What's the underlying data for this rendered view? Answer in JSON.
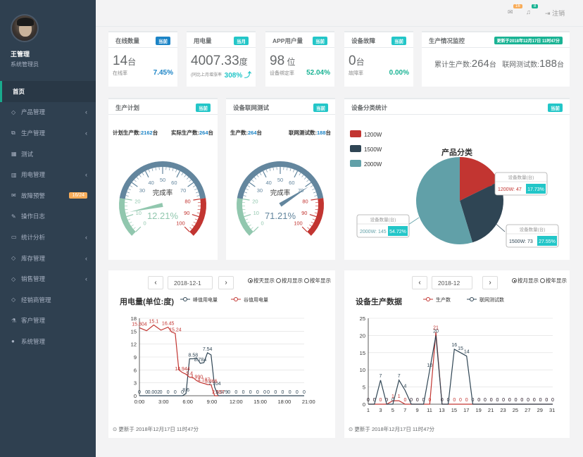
{
  "user": {
    "name": "王管理",
    "role": "系统管理员"
  },
  "nav": [
    {
      "label": "首页",
      "icon": "home",
      "active": true
    },
    {
      "label": "产品管理",
      "icon": "diamond-icon",
      "sym": "◇",
      "arrow": "‹"
    },
    {
      "label": "生产管理",
      "icon": "copy-icon",
      "sym": "⧉",
      "arrow": "‹"
    },
    {
      "label": "测试",
      "icon": "table-icon",
      "sym": "▦"
    },
    {
      "label": "用电管理",
      "icon": "bar-chart-icon",
      "sym": "▥",
      "arrow": "‹"
    },
    {
      "label": "故障预警",
      "icon": "envelope-icon",
      "sym": "✉",
      "badge": "16/24"
    },
    {
      "label": "操作日志",
      "icon": "edit-icon",
      "sym": "✎"
    },
    {
      "label": "统计分析",
      "icon": "desktop-icon",
      "sym": "▭",
      "arrow": "‹"
    },
    {
      "label": "库存管理",
      "icon": "diamond-icon",
      "sym": "◇",
      "arrow": "‹"
    },
    {
      "label": "销售管理",
      "icon": "diamond-icon",
      "sym": "◇",
      "arrow": "‹"
    },
    {
      "label": "经销商管理",
      "icon": "diamond-icon",
      "sym": "◇"
    },
    {
      "label": "客户管理",
      "icon": "flask-icon",
      "sym": "⚗"
    },
    {
      "label": "系统管理",
      "icon": "globe-icon",
      "sym": "●"
    }
  ],
  "topbar": {
    "mail_count": "16",
    "bell_count": "8",
    "logout": "注销"
  },
  "stats": {
    "online": {
      "title": "在线数量",
      "tag": "当前",
      "value": "14",
      "unit": "台",
      "sub": "在线率",
      "pct": "7.45%"
    },
    "power": {
      "title": "用电量",
      "tag": "当月",
      "value": "4007.33",
      "unit": "度",
      "sub": "(同比上月增涨率",
      "pct": "308% ⤴"
    },
    "app": {
      "title": "APP用户量",
      "tag": "当前",
      "value": "98",
      "unit": " 位",
      "sub": "设备绑定率",
      "pct": "52.04%"
    },
    "fault": {
      "title": "设备故障",
      "tag": "当前",
      "value": "0",
      "unit": "台",
      "sub": "故障率",
      "pct": "0.00%"
    },
    "monitor": {
      "title": "生产情况监控",
      "tag": "更新于2018年12月17日 11时47分",
      "a_label": "累计生产数:",
      "a_val": "264",
      "a_unit": "台",
      "b_label": "联网测试数:",
      "b_val": "188",
      "b_unit": "台"
    }
  },
  "plan": {
    "title": "生产计划",
    "tag": "当前",
    "left_label": "计划生产数:",
    "left_val": "2162",
    "left_unit": "台",
    "right_label": "实际生产数:",
    "right_val": "264",
    "right_unit": "台"
  },
  "nettest": {
    "title": "设备联网测试",
    "tag": "当前",
    "left_label": "生产数:",
    "left_val": "264",
    "left_unit": "台",
    "right_label": "联网测试数:",
    "right_val": "188",
    "right_unit": "台"
  },
  "gauges": [
    {
      "label": "完成率",
      "value": 12.21,
      "text": "12.21%",
      "ticks": [
        "0",
        "10",
        "20",
        "30",
        "40",
        "50",
        "60",
        "70",
        "80",
        "90",
        "100"
      ]
    },
    {
      "label": "完成率",
      "value": 71.21,
      "text": "71.21%",
      "ticks": [
        "0",
        "10",
        "20",
        "30",
        "40",
        "50",
        "60",
        "70",
        "80",
        "90",
        "100"
      ]
    }
  ],
  "pie_panel": {
    "title": "设备分类统计",
    "tag": "当前",
    "chart_title": "产品分类"
  },
  "pie": {
    "type": "pie",
    "legend": [
      "1200W",
      "1500W",
      "2000W"
    ],
    "colors": [
      "#c23531",
      "#2f4554",
      "#61a0a8"
    ],
    "values": [
      47,
      73,
      145
    ],
    "callouts": [
      {
        "head": "设备数量(台)",
        "name": "1200W:",
        "val": "47",
        "pct": "17.73%"
      },
      {
        "head": "设备数量(台)",
        "name": "1500W:",
        "val": "73",
        "pct": "27.55%"
      },
      {
        "head": "设备数量(台)",
        "name": "2000W:",
        "val": "145",
        "pct": "54.72%"
      }
    ]
  },
  "power_panel": {
    "date": "2018-12-1",
    "radios": [
      "按天显示",
      "按月显示",
      "按年显示"
    ],
    "selected": 0,
    "footer": "⊙ 更新于 2018年12月17日 11时47分"
  },
  "prod_panel": {
    "date": "2018-12",
    "radios": [
      "按月显示",
      "按年显示"
    ],
    "selected": 0,
    "footer": "⊙ 更新于 2018年12月17日 11时47分"
  },
  "chart_data": [
    {
      "type": "line",
      "title": "用电量(单位:度)",
      "ylim": [
        0,
        18
      ],
      "yticks": [
        "0",
        "3",
        "6",
        "9",
        "12",
        "15",
        "18"
      ],
      "xticks": [
        "0:00",
        "3:00",
        "6:00",
        "9:00",
        "12:00",
        "15:00",
        "18:00",
        "21:00"
      ],
      "series": [
        {
          "name": "峰值用电量",
          "color": "#2f4554",
          "x": [
            0,
            0.5,
            1,
            1.5,
            2,
            2.5,
            3,
            3.5,
            4,
            4.5,
            5,
            5.5,
            6,
            6.5,
            7,
            7.5,
            8,
            8.5,
            9,
            9.5,
            10,
            10.5,
            11,
            11.5,
            12,
            12.5,
            13,
            13.5,
            14,
            14.5,
            15,
            15.5,
            16,
            16.5,
            17,
            17.5,
            18,
            18.5,
            19,
            19.5,
            20,
            20.5,
            21,
            21.5,
            22,
            22.5,
            23
          ],
          "values": [
            0,
            0,
            0.002,
            0,
            0,
            0,
            0,
            0,
            0,
            0,
            0,
            0,
            0,
            0.5,
            8.6,
            8.58,
            8.784,
            7.54,
            7.7,
            9.979,
            9.5,
            2,
            0,
            0,
            0,
            0,
            0,
            0,
            0,
            0,
            0,
            0,
            0,
            0,
            0,
            0,
            0,
            0,
            0,
            0,
            0,
            0,
            0,
            0,
            0,
            0,
            0
          ],
          "labels": [
            "0",
            "0",
            "0.002",
            "0",
            "0",
            "0",
            "0",
            "8.6",
            "8.58",
            "8.784",
            "7.54",
            "7.704",
            "9.979",
            "0",
            "0",
            "0",
            "0",
            "0",
            "0",
            "0",
            "0",
            "0",
            "0",
            "0",
            "0"
          ]
        },
        {
          "name": "谷值用电量",
          "color": "#c23531",
          "x": [
            0,
            1,
            2,
            3,
            4,
            4.5,
            5,
            5.5,
            6,
            6.5,
            7,
            7.5,
            8,
            8.5,
            9,
            9.5,
            10,
            10.5,
            11
          ],
          "values": [
            15.804,
            15.1,
            16.45,
            15.24,
            15.944,
            14.8,
            14.5,
            6,
            5.4,
            5.0,
            4.3,
            4.187,
            3.5,
            3.1,
            2.866,
            2.6,
            2.55,
            0,
            0
          ],
          "labels": [
            "15.804",
            "15.1",
            "16.45",
            "15.24",
            "14.944",
            "5.4",
            "4.990",
            "4.187",
            "3.866",
            "2.557"
          ]
        }
      ]
    },
    {
      "type": "line",
      "title": "设备生产数据",
      "ylim": [
        0,
        25
      ],
      "yticks": [
        "0",
        "5",
        "10",
        "15",
        "20",
        "25"
      ],
      "xticks": [
        "1",
        "3",
        "5",
        "7",
        "9",
        "11",
        "13",
        "15",
        "17",
        "19",
        "21",
        "23",
        "25",
        "27",
        "29",
        "31"
      ],
      "series": [
        {
          "name": "生产数",
          "color": "#c23531",
          "x": [
            1,
            2,
            3,
            4,
            5,
            6,
            7,
            8,
            9,
            10,
            11,
            12,
            13,
            14,
            15,
            16,
            17,
            18,
            19,
            20,
            21,
            22,
            23,
            24,
            25,
            26,
            27,
            28,
            29,
            30,
            31
          ],
          "values": [
            0,
            0,
            0,
            0,
            1,
            1,
            0,
            0,
            0,
            0,
            0,
            21,
            0,
            0,
            0,
            0,
            0,
            0,
            0,
            0,
            0,
            0,
            0,
            0,
            0,
            0,
            0,
            0,
            0,
            0,
            0
          ]
        },
        {
          "name": "联网测试数",
          "color": "#2f4554",
          "x": [
            1,
            2,
            3,
            4,
            5,
            6,
            7,
            8,
            9,
            10,
            11,
            12,
            13,
            14,
            15,
            16,
            17,
            18,
            19,
            20,
            21,
            22,
            23,
            24,
            25,
            26,
            27,
            28,
            29,
            30,
            31
          ],
          "values": [
            0,
            0,
            7,
            0,
            0,
            7,
            4,
            0,
            0,
            0,
            10,
            20,
            0,
            0,
            16,
            15,
            14,
            0,
            0,
            0,
            0,
            0,
            0,
            0,
            0,
            0,
            0,
            0,
            0,
            0,
            0
          ]
        }
      ]
    }
  ]
}
